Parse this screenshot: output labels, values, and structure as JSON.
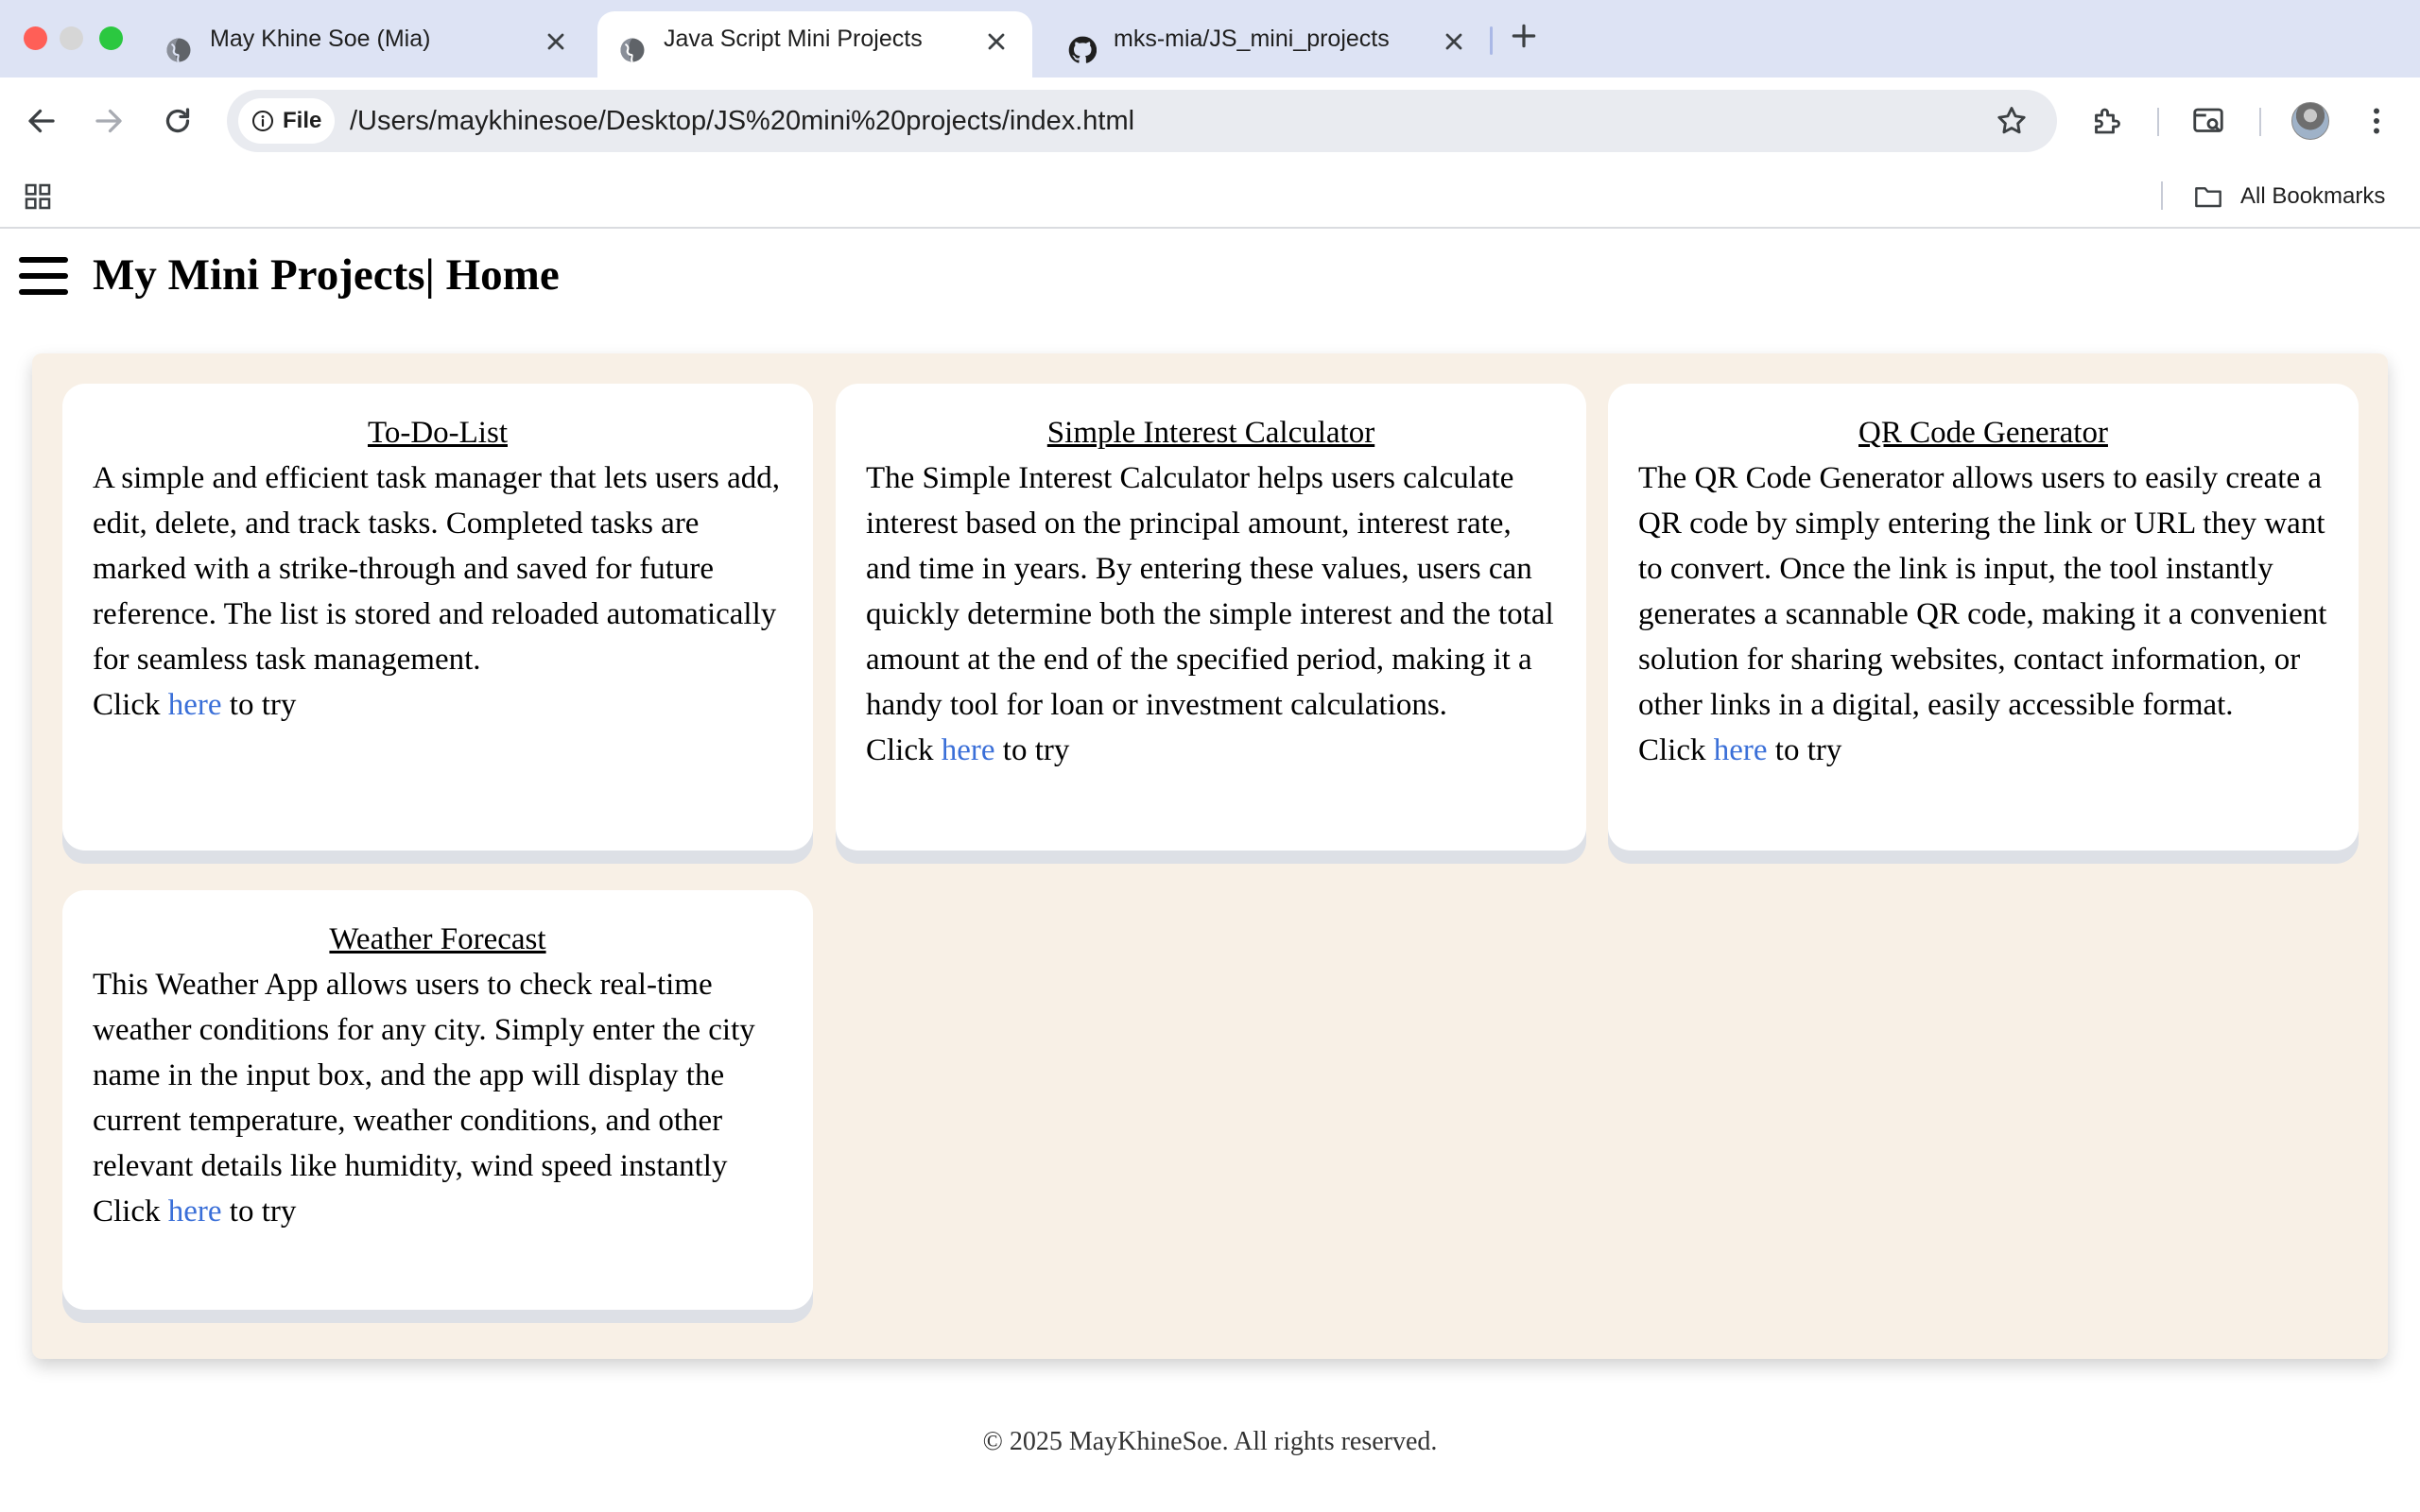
{
  "browser": {
    "tabs": [
      {
        "title": "May Khine Soe (Mia)",
        "favicon": "globe-icon",
        "active": false
      },
      {
        "title": "Java Script Mini Projects",
        "favicon": "globe-icon",
        "active": true
      },
      {
        "title": "mks-mia/JS_mini_projects",
        "favicon": "github-icon",
        "active": false
      }
    ],
    "address": {
      "chip_label": "File",
      "url": "/Users/maykhinesoe/Desktop/JS%20mini%20projects/index.html"
    },
    "bookmarks_bar": {
      "all_bookmarks_label": "All Bookmarks"
    }
  },
  "page": {
    "title": "My Mini Projects| Home",
    "cards": [
      {
        "title": "To-Do-List",
        "description": "A simple and efficient task manager that lets users add, edit, delete, and track tasks. Completed tasks are marked with a strike-through and saved for future reference. The list is stored and reloaded automatically for seamless task management.",
        "cta_prefix": "Click ",
        "cta_link": "here",
        "cta_suffix": " to try"
      },
      {
        "title": "Simple Interest Calculator",
        "description": "The Simple Interest Calculator helps users calculate interest based on the principal amount, interest rate, and time in years. By entering these values, users can quickly determine both the simple interest and the total amount at the end of the specified period, making it a handy tool for loan or investment calculations.",
        "cta_prefix": "Click ",
        "cta_link": "here",
        "cta_suffix": " to try"
      },
      {
        "title": "QR Code Generator",
        "description": "The QR Code Generator allows users to easily create a QR code by simply entering the link or URL they want to convert. Once the link is input, the tool instantly generates a scannable QR code, making it a convenient solution for sharing websites, contact information, or other links in a digital, easily accessible format.",
        "cta_prefix": "Click ",
        "cta_link": "here",
        "cta_suffix": " to try"
      },
      {
        "title": "Weather Forecast",
        "description": "This Weather App allows users to check real-time weather conditions for any city. Simply enter the city name in the input box, and the app will display the current temperature, weather conditions, and other relevant details like humidity, wind speed instantly",
        "cta_prefix": "Click ",
        "cta_link": "here",
        "cta_suffix": " to try"
      }
    ],
    "footer": "© 2025 MayKhineSoe. All rights reserved."
  },
  "colors": {
    "tabstrip_bg": "#dde3f4",
    "container_bg": "#f8f0e6",
    "link": "#3a6fd8"
  }
}
